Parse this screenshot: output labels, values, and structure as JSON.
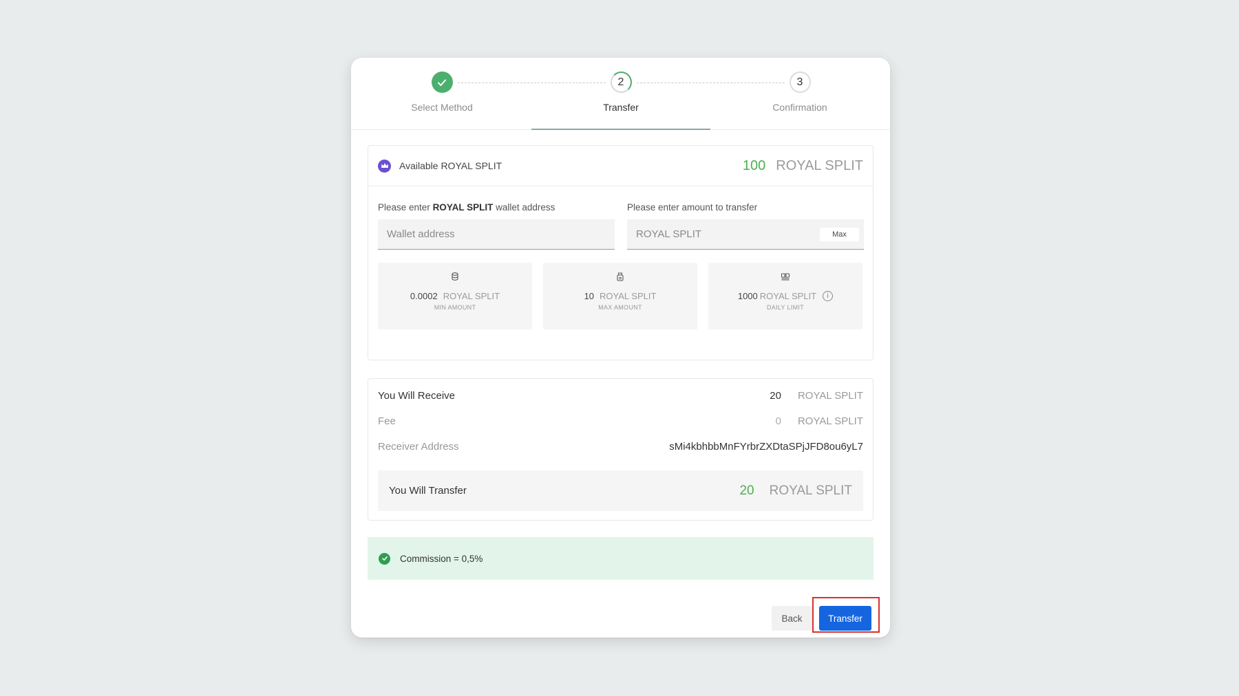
{
  "stepper": {
    "steps": [
      {
        "number": "",
        "label": "Select Method",
        "state": "done",
        "icon": "check-icon"
      },
      {
        "number": "2",
        "label": "Transfer",
        "state": "active"
      },
      {
        "number": "3",
        "label": "Confirmation",
        "state": "pending"
      }
    ]
  },
  "available": {
    "icon": "crown-icon",
    "label": "Available ROYAL SPLIT",
    "amount": "100",
    "currency": "ROYAL SPLIT"
  },
  "wallet_field": {
    "label_prefix": "Please enter ",
    "label_bold": "ROYAL SPLIT",
    "label_suffix": " wallet address",
    "placeholder": "Wallet address",
    "value": ""
  },
  "amount_field": {
    "label": "Please enter amount to transfer",
    "placeholder": "ROYAL SPLIT",
    "value": "",
    "max_label": "Max"
  },
  "limits": [
    {
      "icon": "coin-stack-icon",
      "value": "0.0002",
      "currency": "ROYAL SPLIT",
      "caption": "MIN AMOUNT"
    },
    {
      "icon": "coin-bag-icon",
      "value": "10",
      "currency": "ROYAL SPLIT",
      "caption": "MAX AMOUNT"
    },
    {
      "icon": "cash-stack-icon",
      "value": "1000",
      "currency": "ROYAL SPLIT",
      "caption": "DAILY LIMIT",
      "info": "i"
    }
  ],
  "summary": {
    "receive_label": "You Will Receive",
    "receive_amount": "20",
    "receive_currency": "ROYAL SPLIT",
    "fee_label": "Fee",
    "fee_amount": "0",
    "fee_currency": "ROYAL SPLIT",
    "address_label": "Receiver Address",
    "address_value": "sMi4kbhbbMnFYrbrZXDtaSPjJFD8ou6yL7",
    "transfer_label": "You Will Transfer",
    "transfer_amount": "20",
    "transfer_currency": "ROYAL SPLIT"
  },
  "commission": {
    "icon": "check-circle-icon",
    "text": "Commission = 0,5%"
  },
  "footer": {
    "back_label": "Back",
    "transfer_label": "Transfer"
  },
  "colors": {
    "accent_green": "#4caf50",
    "primary_blue": "#1565e0",
    "highlight_red": "#d9302a",
    "crown_purple": "#6a4fd2"
  }
}
